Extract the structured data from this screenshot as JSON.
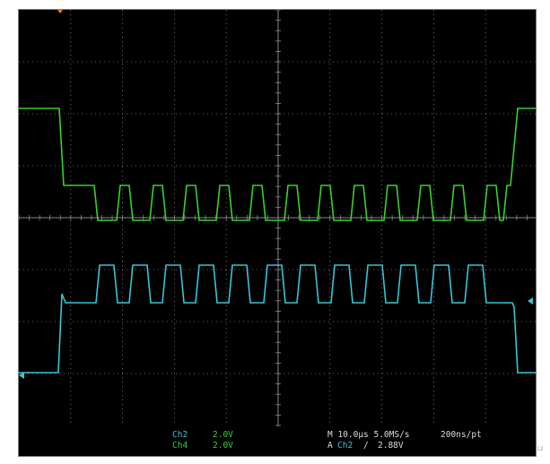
{
  "header": {
    "caption": ""
  },
  "colors": {
    "background": "#000000",
    "grid": "#8a8a8a",
    "ch4_trace": "#39d12a",
    "ch2_trace": "#36c6d6",
    "trigger_marker": "#ff7a1a",
    "label_text": "#dddddd"
  },
  "icons": {
    "trigger_position": "orange-down-triangle",
    "ch2_level_marker": "cyan-left-arrow",
    "trigger_level_marker": "cyan-right-arrow"
  },
  "channels": [
    {
      "name": "Ch2",
      "scale": "2.0V"
    },
    {
      "name": "Ch4",
      "scale": "2.0V"
    }
  ],
  "timebase": {
    "main": "M 10.0µs 5.0MS/s",
    "resolution": "200ns/pt"
  },
  "trigger": {
    "label": "A",
    "source": "Ch2",
    "slope": "/",
    "level": "2.88V"
  },
  "corner_note": "12"
}
